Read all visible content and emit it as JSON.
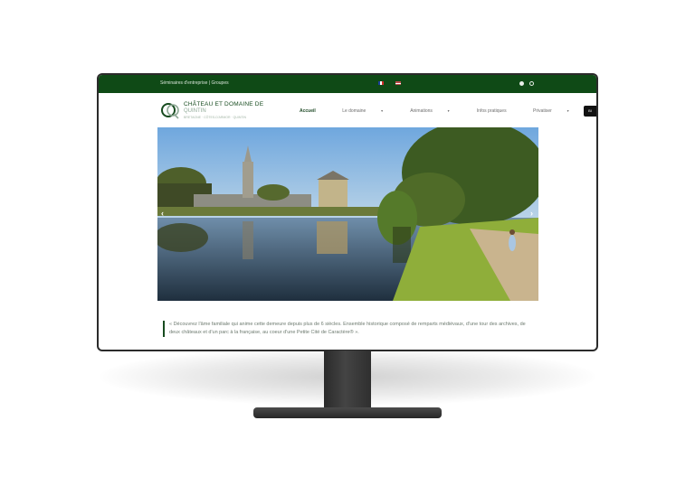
{
  "topbar": {
    "links": "Séminaires d'entreprise | Groupes",
    "languages": [
      "FR",
      "EN"
    ],
    "social_icons": [
      "facebook-icon",
      "instagram-icon"
    ]
  },
  "header": {
    "logo_icon": "monogram-logo-icon",
    "brand": "CHÂTEAU ET DOMAINE DE",
    "brand_sub": "QUINTIN",
    "brand_tagline": "BRETAGNE · CÔTES-D'ARMOR · QUINTIN",
    "nav": [
      {
        "label": "Accueil",
        "dropdown": false,
        "active": true
      },
      {
        "label": "Le domaine",
        "dropdown": true,
        "active": false
      },
      {
        "label": "Animations",
        "dropdown": true,
        "active": false
      },
      {
        "label": "Infos pratiques",
        "dropdown": false,
        "active": false
      },
      {
        "label": "Privatiser",
        "dropdown": true,
        "active": false
      }
    ],
    "side_tab": "BI"
  },
  "hero": {
    "prev_arrow": "‹",
    "next_arrow": "›"
  },
  "intro": {
    "text": "« Découvrez l'âme familiale qui anime cette demeure depuis plus de 6 siècles. Ensemble historique composé de remparts médiévaux, d'une tour des archives, de deux châteaux et d'un parc à la française, au coeur d'une Petite Cité de Caractère® »."
  },
  "colors": {
    "brand_green": "#0f4a16",
    "monitor_frame": "#2b2b2b"
  }
}
